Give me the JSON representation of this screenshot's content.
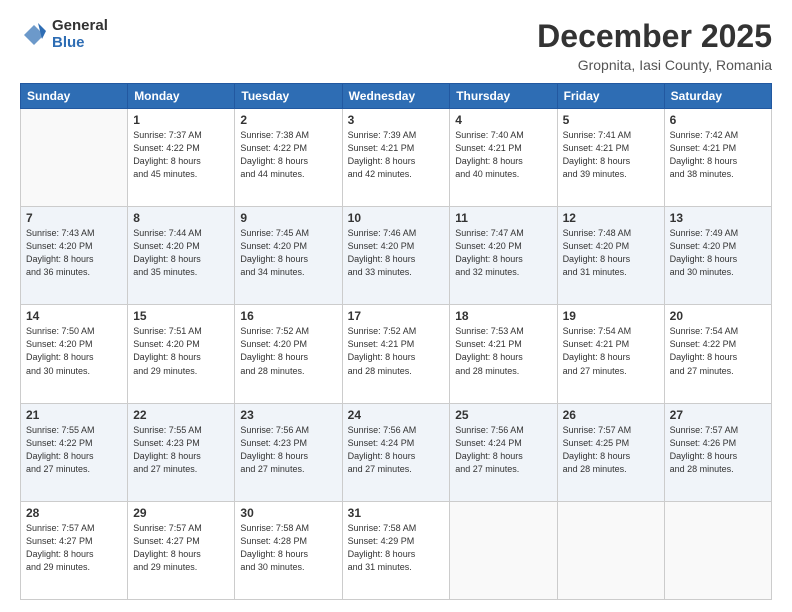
{
  "logo": {
    "general": "General",
    "blue": "Blue"
  },
  "header": {
    "month": "December 2025",
    "subtitle": "Gropnita, Iasi County, Romania"
  },
  "weekdays": [
    "Sunday",
    "Monday",
    "Tuesday",
    "Wednesday",
    "Thursday",
    "Friday",
    "Saturday"
  ],
  "weeks": [
    [
      {
        "day": "",
        "info": ""
      },
      {
        "day": "1",
        "info": "Sunrise: 7:37 AM\nSunset: 4:22 PM\nDaylight: 8 hours\nand 45 minutes."
      },
      {
        "day": "2",
        "info": "Sunrise: 7:38 AM\nSunset: 4:22 PM\nDaylight: 8 hours\nand 44 minutes."
      },
      {
        "day": "3",
        "info": "Sunrise: 7:39 AM\nSunset: 4:21 PM\nDaylight: 8 hours\nand 42 minutes."
      },
      {
        "day": "4",
        "info": "Sunrise: 7:40 AM\nSunset: 4:21 PM\nDaylight: 8 hours\nand 40 minutes."
      },
      {
        "day": "5",
        "info": "Sunrise: 7:41 AM\nSunset: 4:21 PM\nDaylight: 8 hours\nand 39 minutes."
      },
      {
        "day": "6",
        "info": "Sunrise: 7:42 AM\nSunset: 4:21 PM\nDaylight: 8 hours\nand 38 minutes."
      }
    ],
    [
      {
        "day": "7",
        "info": "Sunrise: 7:43 AM\nSunset: 4:20 PM\nDaylight: 8 hours\nand 36 minutes."
      },
      {
        "day": "8",
        "info": "Sunrise: 7:44 AM\nSunset: 4:20 PM\nDaylight: 8 hours\nand 35 minutes."
      },
      {
        "day": "9",
        "info": "Sunrise: 7:45 AM\nSunset: 4:20 PM\nDaylight: 8 hours\nand 34 minutes."
      },
      {
        "day": "10",
        "info": "Sunrise: 7:46 AM\nSunset: 4:20 PM\nDaylight: 8 hours\nand 33 minutes."
      },
      {
        "day": "11",
        "info": "Sunrise: 7:47 AM\nSunset: 4:20 PM\nDaylight: 8 hours\nand 32 minutes."
      },
      {
        "day": "12",
        "info": "Sunrise: 7:48 AM\nSunset: 4:20 PM\nDaylight: 8 hours\nand 31 minutes."
      },
      {
        "day": "13",
        "info": "Sunrise: 7:49 AM\nSunset: 4:20 PM\nDaylight: 8 hours\nand 30 minutes."
      }
    ],
    [
      {
        "day": "14",
        "info": "Sunrise: 7:50 AM\nSunset: 4:20 PM\nDaylight: 8 hours\nand 30 minutes."
      },
      {
        "day": "15",
        "info": "Sunrise: 7:51 AM\nSunset: 4:20 PM\nDaylight: 8 hours\nand 29 minutes."
      },
      {
        "day": "16",
        "info": "Sunrise: 7:52 AM\nSunset: 4:20 PM\nDaylight: 8 hours\nand 28 minutes."
      },
      {
        "day": "17",
        "info": "Sunrise: 7:52 AM\nSunset: 4:21 PM\nDaylight: 8 hours\nand 28 minutes."
      },
      {
        "day": "18",
        "info": "Sunrise: 7:53 AM\nSunset: 4:21 PM\nDaylight: 8 hours\nand 28 minutes."
      },
      {
        "day": "19",
        "info": "Sunrise: 7:54 AM\nSunset: 4:21 PM\nDaylight: 8 hours\nand 27 minutes."
      },
      {
        "day": "20",
        "info": "Sunrise: 7:54 AM\nSunset: 4:22 PM\nDaylight: 8 hours\nand 27 minutes."
      }
    ],
    [
      {
        "day": "21",
        "info": "Sunrise: 7:55 AM\nSunset: 4:22 PM\nDaylight: 8 hours\nand 27 minutes."
      },
      {
        "day": "22",
        "info": "Sunrise: 7:55 AM\nSunset: 4:23 PM\nDaylight: 8 hours\nand 27 minutes."
      },
      {
        "day": "23",
        "info": "Sunrise: 7:56 AM\nSunset: 4:23 PM\nDaylight: 8 hours\nand 27 minutes."
      },
      {
        "day": "24",
        "info": "Sunrise: 7:56 AM\nSunset: 4:24 PM\nDaylight: 8 hours\nand 27 minutes."
      },
      {
        "day": "25",
        "info": "Sunrise: 7:56 AM\nSunset: 4:24 PM\nDaylight: 8 hours\nand 27 minutes."
      },
      {
        "day": "26",
        "info": "Sunrise: 7:57 AM\nSunset: 4:25 PM\nDaylight: 8 hours\nand 28 minutes."
      },
      {
        "day": "27",
        "info": "Sunrise: 7:57 AM\nSunset: 4:26 PM\nDaylight: 8 hours\nand 28 minutes."
      }
    ],
    [
      {
        "day": "28",
        "info": "Sunrise: 7:57 AM\nSunset: 4:27 PM\nDaylight: 8 hours\nand 29 minutes."
      },
      {
        "day": "29",
        "info": "Sunrise: 7:57 AM\nSunset: 4:27 PM\nDaylight: 8 hours\nand 29 minutes."
      },
      {
        "day": "30",
        "info": "Sunrise: 7:58 AM\nSunset: 4:28 PM\nDaylight: 8 hours\nand 30 minutes."
      },
      {
        "day": "31",
        "info": "Sunrise: 7:58 AM\nSunset: 4:29 PM\nDaylight: 8 hours\nand 31 minutes."
      },
      {
        "day": "",
        "info": ""
      },
      {
        "day": "",
        "info": ""
      },
      {
        "day": "",
        "info": ""
      }
    ]
  ]
}
